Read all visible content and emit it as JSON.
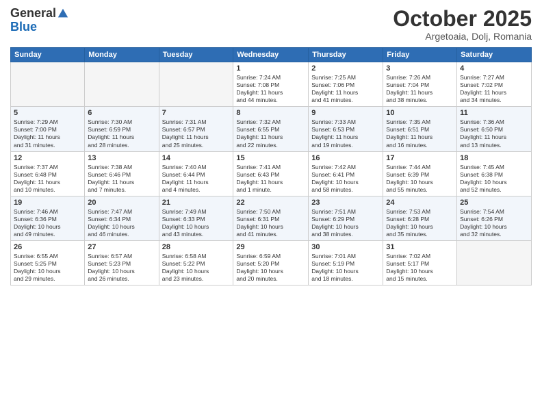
{
  "header": {
    "logo_line1": "General",
    "logo_line2": "Blue",
    "month": "October 2025",
    "location": "Argetoaia, Dolj, Romania"
  },
  "days_of_week": [
    "Sunday",
    "Monday",
    "Tuesday",
    "Wednesday",
    "Thursday",
    "Friday",
    "Saturday"
  ],
  "weeks": [
    [
      {
        "day": "",
        "empty": true
      },
      {
        "day": "",
        "empty": true
      },
      {
        "day": "",
        "empty": true
      },
      {
        "day": "1",
        "lines": [
          "Sunrise: 7:24 AM",
          "Sunset: 7:08 PM",
          "Daylight: 11 hours",
          "and 44 minutes."
        ]
      },
      {
        "day": "2",
        "lines": [
          "Sunrise: 7:25 AM",
          "Sunset: 7:06 PM",
          "Daylight: 11 hours",
          "and 41 minutes."
        ]
      },
      {
        "day": "3",
        "lines": [
          "Sunrise: 7:26 AM",
          "Sunset: 7:04 PM",
          "Daylight: 11 hours",
          "and 38 minutes."
        ]
      },
      {
        "day": "4",
        "lines": [
          "Sunrise: 7:27 AM",
          "Sunset: 7:02 PM",
          "Daylight: 11 hours",
          "and 34 minutes."
        ]
      }
    ],
    [
      {
        "day": "5",
        "lines": [
          "Sunrise: 7:29 AM",
          "Sunset: 7:00 PM",
          "Daylight: 11 hours",
          "and 31 minutes."
        ]
      },
      {
        "day": "6",
        "lines": [
          "Sunrise: 7:30 AM",
          "Sunset: 6:59 PM",
          "Daylight: 11 hours",
          "and 28 minutes."
        ]
      },
      {
        "day": "7",
        "lines": [
          "Sunrise: 7:31 AM",
          "Sunset: 6:57 PM",
          "Daylight: 11 hours",
          "and 25 minutes."
        ]
      },
      {
        "day": "8",
        "lines": [
          "Sunrise: 7:32 AM",
          "Sunset: 6:55 PM",
          "Daylight: 11 hours",
          "and 22 minutes."
        ]
      },
      {
        "day": "9",
        "lines": [
          "Sunrise: 7:33 AM",
          "Sunset: 6:53 PM",
          "Daylight: 11 hours",
          "and 19 minutes."
        ]
      },
      {
        "day": "10",
        "lines": [
          "Sunrise: 7:35 AM",
          "Sunset: 6:51 PM",
          "Daylight: 11 hours",
          "and 16 minutes."
        ]
      },
      {
        "day": "11",
        "lines": [
          "Sunrise: 7:36 AM",
          "Sunset: 6:50 PM",
          "Daylight: 11 hours",
          "and 13 minutes."
        ]
      }
    ],
    [
      {
        "day": "12",
        "lines": [
          "Sunrise: 7:37 AM",
          "Sunset: 6:48 PM",
          "Daylight: 11 hours",
          "and 10 minutes."
        ]
      },
      {
        "day": "13",
        "lines": [
          "Sunrise: 7:38 AM",
          "Sunset: 6:46 PM",
          "Daylight: 11 hours",
          "and 7 minutes."
        ]
      },
      {
        "day": "14",
        "lines": [
          "Sunrise: 7:40 AM",
          "Sunset: 6:44 PM",
          "Daylight: 11 hours",
          "and 4 minutes."
        ]
      },
      {
        "day": "15",
        "lines": [
          "Sunrise: 7:41 AM",
          "Sunset: 6:43 PM",
          "Daylight: 11 hours",
          "and 1 minute."
        ]
      },
      {
        "day": "16",
        "lines": [
          "Sunrise: 7:42 AM",
          "Sunset: 6:41 PM",
          "Daylight: 10 hours",
          "and 58 minutes."
        ]
      },
      {
        "day": "17",
        "lines": [
          "Sunrise: 7:44 AM",
          "Sunset: 6:39 PM",
          "Daylight: 10 hours",
          "and 55 minutes."
        ]
      },
      {
        "day": "18",
        "lines": [
          "Sunrise: 7:45 AM",
          "Sunset: 6:38 PM",
          "Daylight: 10 hours",
          "and 52 minutes."
        ]
      }
    ],
    [
      {
        "day": "19",
        "lines": [
          "Sunrise: 7:46 AM",
          "Sunset: 6:36 PM",
          "Daylight: 10 hours",
          "and 49 minutes."
        ]
      },
      {
        "day": "20",
        "lines": [
          "Sunrise: 7:47 AM",
          "Sunset: 6:34 PM",
          "Daylight: 10 hours",
          "and 46 minutes."
        ]
      },
      {
        "day": "21",
        "lines": [
          "Sunrise: 7:49 AM",
          "Sunset: 6:33 PM",
          "Daylight: 10 hours",
          "and 43 minutes."
        ]
      },
      {
        "day": "22",
        "lines": [
          "Sunrise: 7:50 AM",
          "Sunset: 6:31 PM",
          "Daylight: 10 hours",
          "and 41 minutes."
        ]
      },
      {
        "day": "23",
        "lines": [
          "Sunrise: 7:51 AM",
          "Sunset: 6:29 PM",
          "Daylight: 10 hours",
          "and 38 minutes."
        ]
      },
      {
        "day": "24",
        "lines": [
          "Sunrise: 7:53 AM",
          "Sunset: 6:28 PM",
          "Daylight: 10 hours",
          "and 35 minutes."
        ]
      },
      {
        "day": "25",
        "lines": [
          "Sunrise: 7:54 AM",
          "Sunset: 6:26 PM",
          "Daylight: 10 hours",
          "and 32 minutes."
        ]
      }
    ],
    [
      {
        "day": "26",
        "lines": [
          "Sunrise: 6:55 AM",
          "Sunset: 5:25 PM",
          "Daylight: 10 hours",
          "and 29 minutes."
        ]
      },
      {
        "day": "27",
        "lines": [
          "Sunrise: 6:57 AM",
          "Sunset: 5:23 PM",
          "Daylight: 10 hours",
          "and 26 minutes."
        ]
      },
      {
        "day": "28",
        "lines": [
          "Sunrise: 6:58 AM",
          "Sunset: 5:22 PM",
          "Daylight: 10 hours",
          "and 23 minutes."
        ]
      },
      {
        "day": "29",
        "lines": [
          "Sunrise: 6:59 AM",
          "Sunset: 5:20 PM",
          "Daylight: 10 hours",
          "and 20 minutes."
        ]
      },
      {
        "day": "30",
        "lines": [
          "Sunrise: 7:01 AM",
          "Sunset: 5:19 PM",
          "Daylight: 10 hours",
          "and 18 minutes."
        ]
      },
      {
        "day": "31",
        "lines": [
          "Sunrise: 7:02 AM",
          "Sunset: 5:17 PM",
          "Daylight: 10 hours",
          "and 15 minutes."
        ]
      },
      {
        "day": "",
        "empty": true
      }
    ]
  ]
}
